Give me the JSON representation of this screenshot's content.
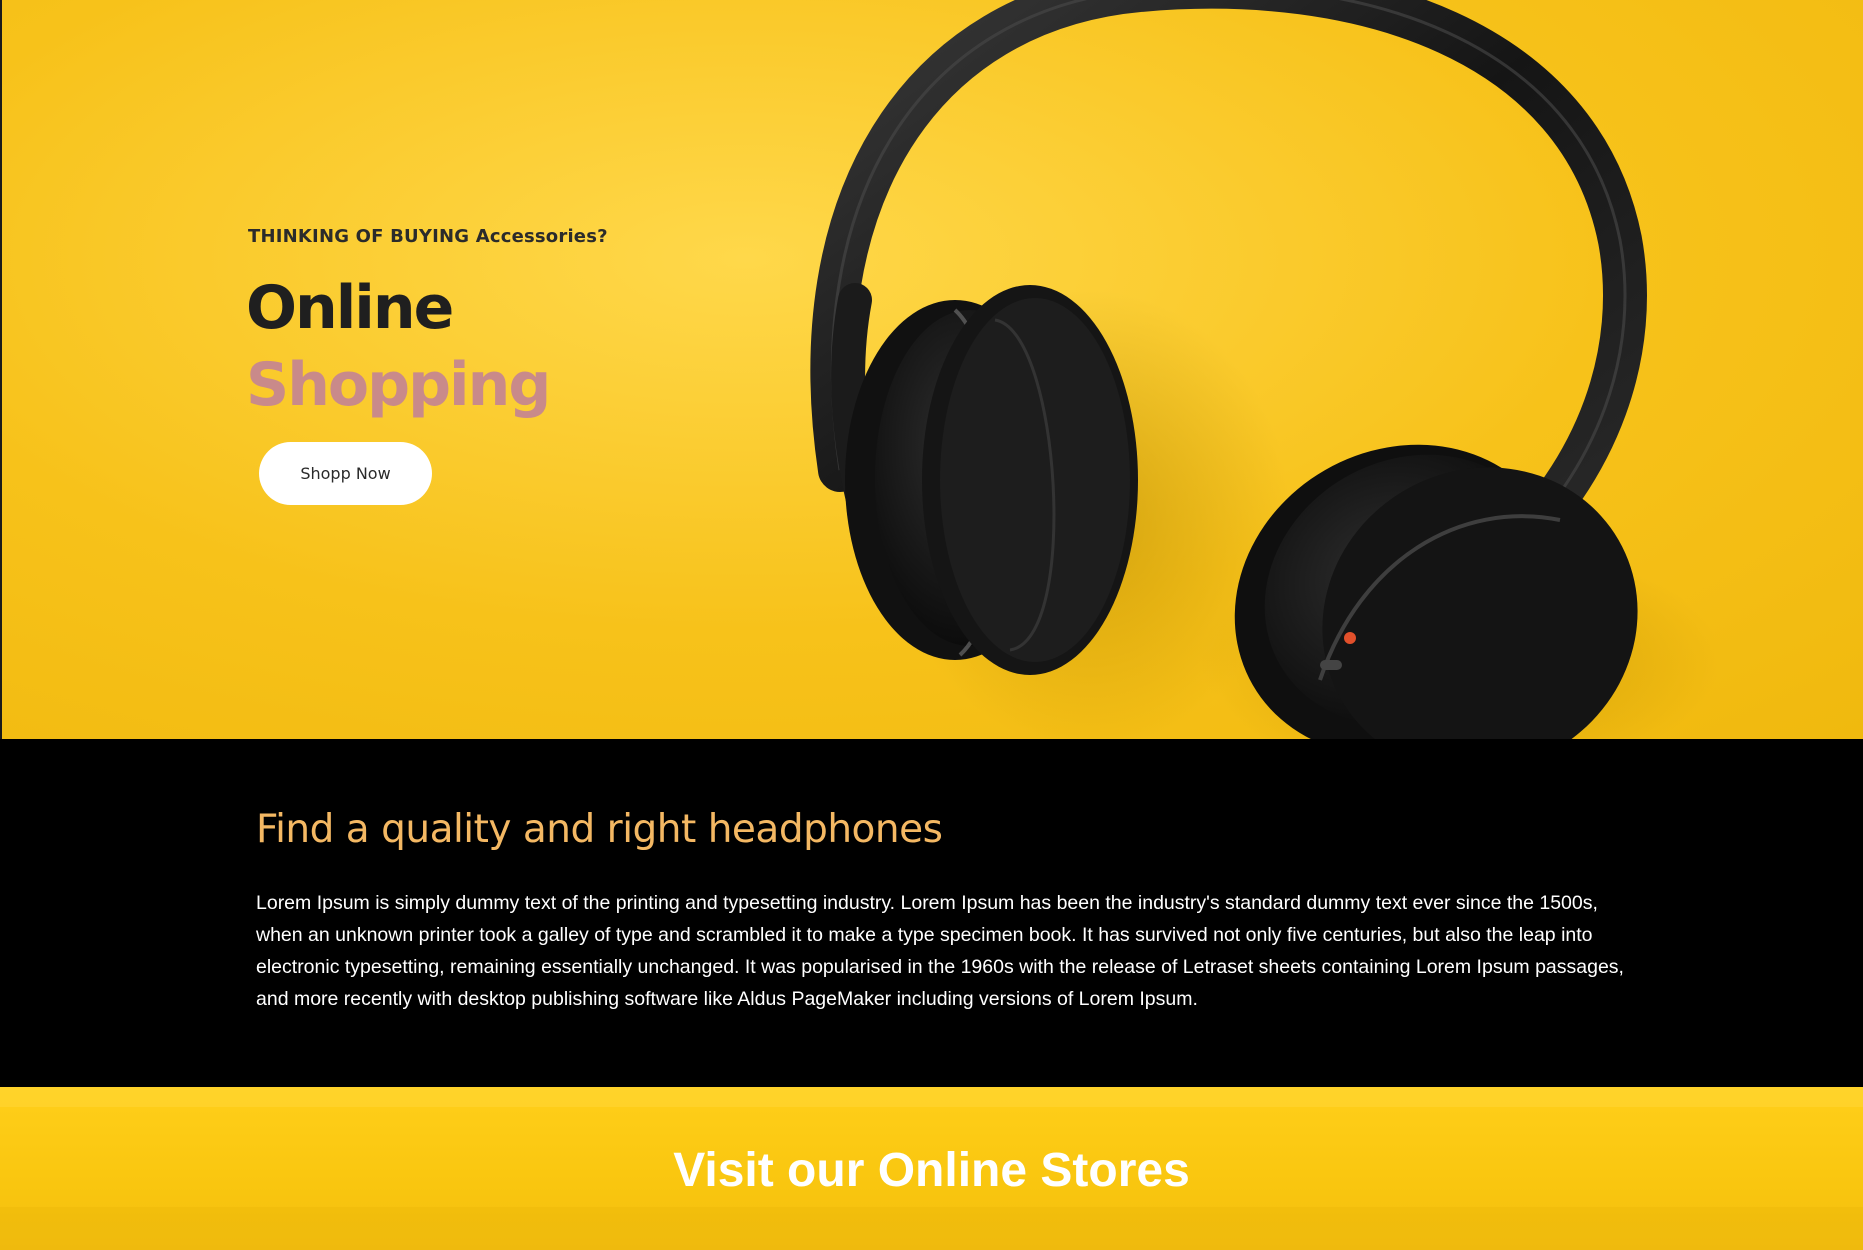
{
  "hero": {
    "kicker": "THINKING OF BUYING Accessories?",
    "title_line1": "Online",
    "title_line2": "Shopping",
    "cta_label": "Shopp Now",
    "image": "headphones-photo"
  },
  "info": {
    "heading": "Find a quality and right headphones",
    "body": "Lorem Ipsum is simply dummy text of the printing and typesetting industry. Lorem Ipsum has been the industry's standard dummy text ever since the 1500s, when an unknown printer took a galley of type and scrambled it to make a type specimen book. It has survived not only five centuries, but also the leap into electronic typesetting, remaining essentially unchanged. It was popularised in the 1960s with the release of Letraset sheets containing Lorem Ipsum passages, and more recently with desktop publishing software like Aldus PageMaker including versions of Lorem Ipsum."
  },
  "stores": {
    "heading": "Visit our Online Stores"
  },
  "colors": {
    "hero_yellow": "#f7c21a",
    "title_dark": "#1f1f1f",
    "title_accent": "#c98a8a",
    "heading_gold": "#f4b863",
    "section_black": "#000000"
  }
}
